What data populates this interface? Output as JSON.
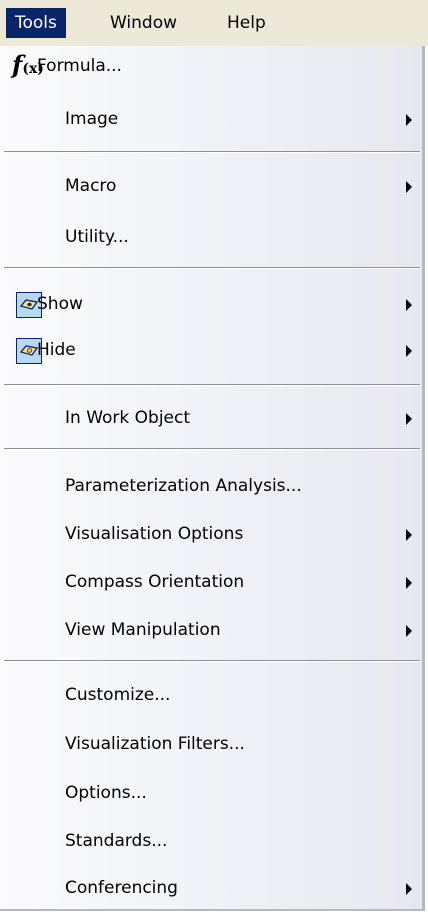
{
  "menubar": {
    "items": [
      {
        "label": "Tools",
        "active": true
      },
      {
        "label": "Window"
      },
      {
        "label": "Help"
      }
    ]
  },
  "menu": {
    "formula": {
      "icon": "formula-fx-icon",
      "label": "Formula..."
    },
    "image": {
      "label": "Image"
    },
    "macro": {
      "label": "Macro"
    },
    "utility": {
      "label": "Utility..."
    },
    "show": {
      "icon": "show-eye-icon",
      "label": "Show"
    },
    "hide": {
      "icon": "hide-eye-icon",
      "label": "Hide"
    },
    "in_work_object": {
      "label": "In Work Object"
    },
    "parameterization_analysis": {
      "label": "Parameterization Analysis..."
    },
    "visualisation_options": {
      "label": "Visualisation Options"
    },
    "compass_orientation": {
      "label": "Compass Orientation"
    },
    "view_manipulation": {
      "label": "View Manipulation"
    },
    "customize": {
      "label": "Customize..."
    },
    "visualization_filters": {
      "label": "Visualization Filters..."
    },
    "options": {
      "label": "Options..."
    },
    "standards": {
      "label": "Standards..."
    },
    "conferencing": {
      "label": "Conferencing"
    }
  },
  "colors": {
    "highlight": "#0a246a",
    "icon_bg": "#b6d8f0"
  }
}
